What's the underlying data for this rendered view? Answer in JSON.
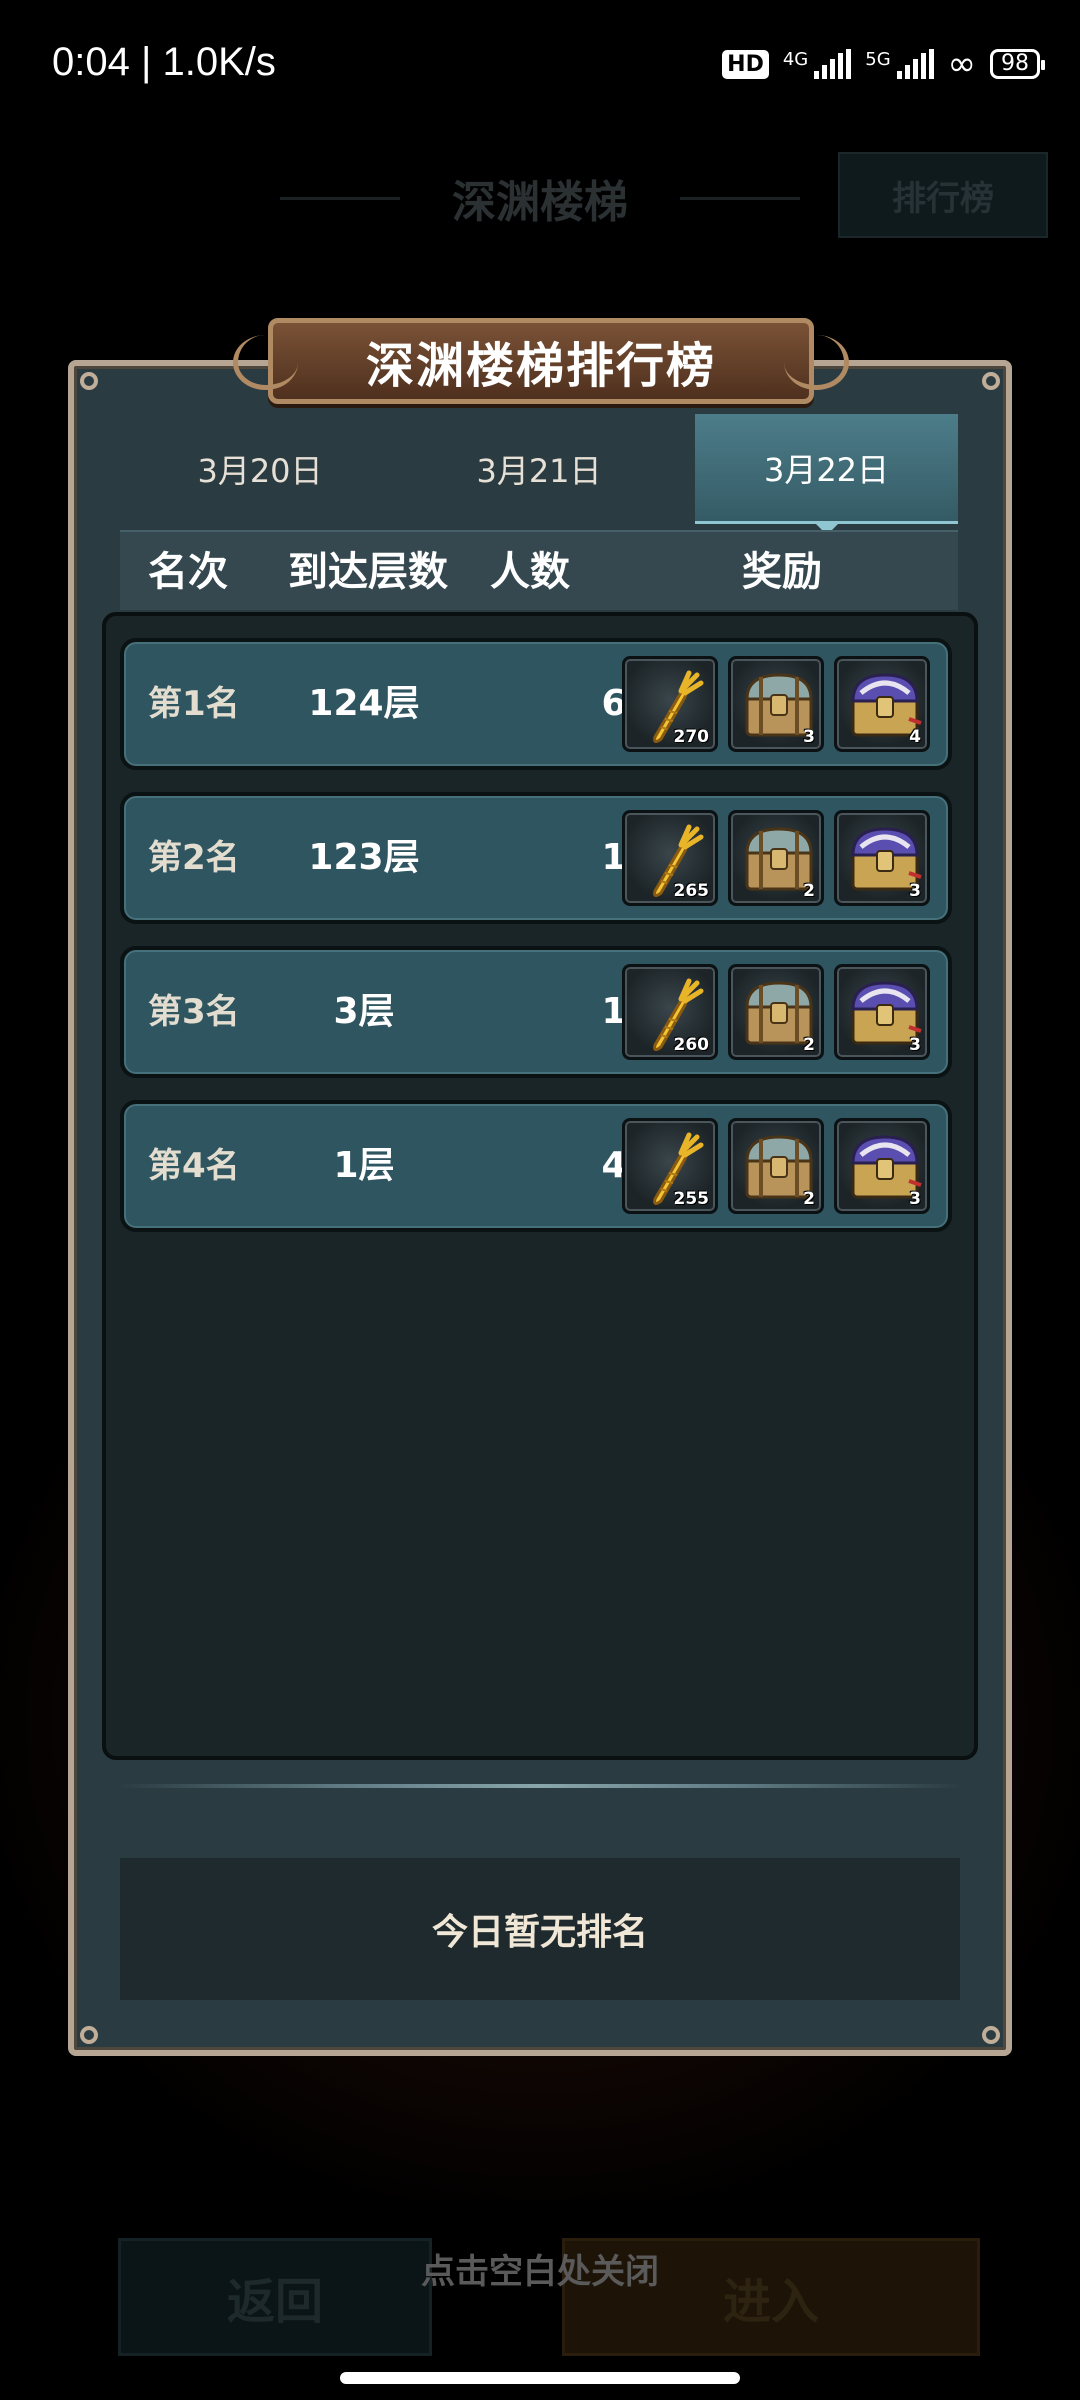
{
  "status_bar": {
    "time_speed": "0:04 | 1.0K/s",
    "hd_label": "HD",
    "net1": "4G",
    "net2": "5G",
    "battery": "98"
  },
  "background": {
    "title": "深渊楼梯",
    "rank_button": "排行榜",
    "back_button": "返回",
    "enter_button": "进入"
  },
  "panel": {
    "title": "深渊楼梯排行榜",
    "tabs": [
      {
        "label": "3月20日",
        "active": false
      },
      {
        "label": "3月21日",
        "active": false
      },
      {
        "label": "3月22日",
        "active": true
      }
    ],
    "columns": {
      "rank": "名次",
      "floor": "到达层数",
      "count": "人数",
      "reward": "奖励"
    },
    "rows": [
      {
        "rank": "第1名",
        "floor": "124层",
        "count": "6",
        "rewards": [
          {
            "icon": "carrot-icon",
            "qty": "270"
          },
          {
            "icon": "bronze-chest-icon",
            "qty": "3"
          },
          {
            "icon": "purple-chest-icon",
            "qty": "4"
          }
        ]
      },
      {
        "rank": "第2名",
        "floor": "123层",
        "count": "1",
        "rewards": [
          {
            "icon": "carrot-icon",
            "qty": "265"
          },
          {
            "icon": "bronze-chest-icon",
            "qty": "2"
          },
          {
            "icon": "purple-chest-icon",
            "qty": "3"
          }
        ]
      },
      {
        "rank": "第3名",
        "floor": "3层",
        "count": "1",
        "rewards": [
          {
            "icon": "carrot-icon",
            "qty": "260"
          },
          {
            "icon": "bronze-chest-icon",
            "qty": "2"
          },
          {
            "icon": "purple-chest-icon",
            "qty": "3"
          }
        ]
      },
      {
        "rank": "第4名",
        "floor": "1层",
        "count": "4",
        "rewards": [
          {
            "icon": "carrot-icon",
            "qty": "255"
          },
          {
            "icon": "bronze-chest-icon",
            "qty": "2"
          },
          {
            "icon": "purple-chest-icon",
            "qty": "3"
          }
        ]
      }
    ],
    "my_rank": "今日暂无排名"
  },
  "close_hint": "点击空白处关闭",
  "colors": {
    "panel_bg": "#2b3b42",
    "panel_border": "#b6a592",
    "row_bg": "#2f5560",
    "active_tab": "#4d7d8a",
    "title_bg": "#6a4630"
  }
}
